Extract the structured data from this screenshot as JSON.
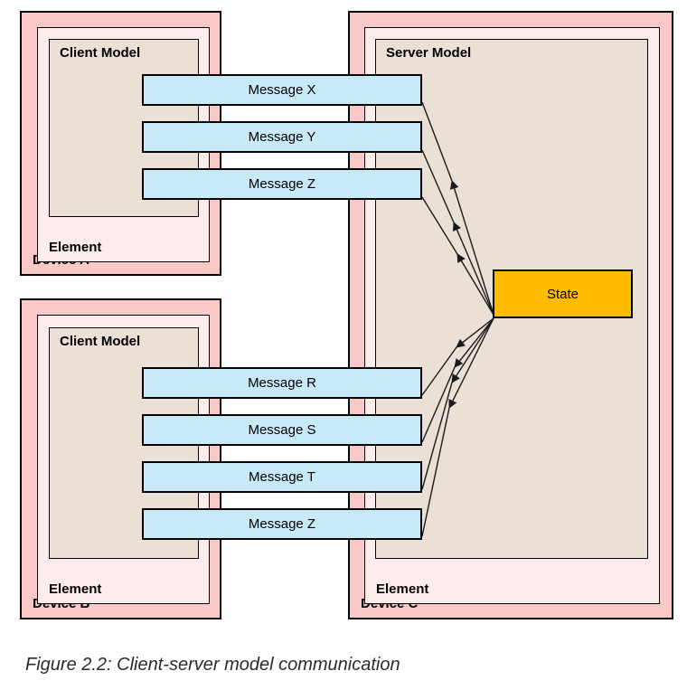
{
  "figure": {
    "caption": "Figure 2.2: Client-server model communication",
    "colors": {
      "device_fill": "#FBC8C8",
      "element_fill": "#FDECEC",
      "model_fill": "#EAE0D5",
      "message_fill": "#C7E9F8",
      "state_fill": "#FFBB00",
      "stroke": "#000000"
    }
  },
  "devices": [
    {
      "id": "device-a",
      "label": "Device A",
      "element_label": "Element",
      "model_label": "Client Model",
      "model_role": "client"
    },
    {
      "id": "device-b",
      "label": "Device B",
      "element_label": "Element",
      "model_label": "Client Model",
      "model_role": "client"
    },
    {
      "id": "device-c",
      "label": "Device C",
      "element_label": "Element",
      "model_label": "Server Model",
      "model_role": "server"
    }
  ],
  "messages": {
    "device_a": [
      {
        "label": "Message X"
      },
      {
        "label": "Message Y"
      },
      {
        "label": "Message Z"
      }
    ],
    "device_b": [
      {
        "label": "Message R"
      },
      {
        "label": "Message S"
      },
      {
        "label": "Message T"
      },
      {
        "label": "Message Z"
      }
    ]
  },
  "state": {
    "label": "State"
  }
}
